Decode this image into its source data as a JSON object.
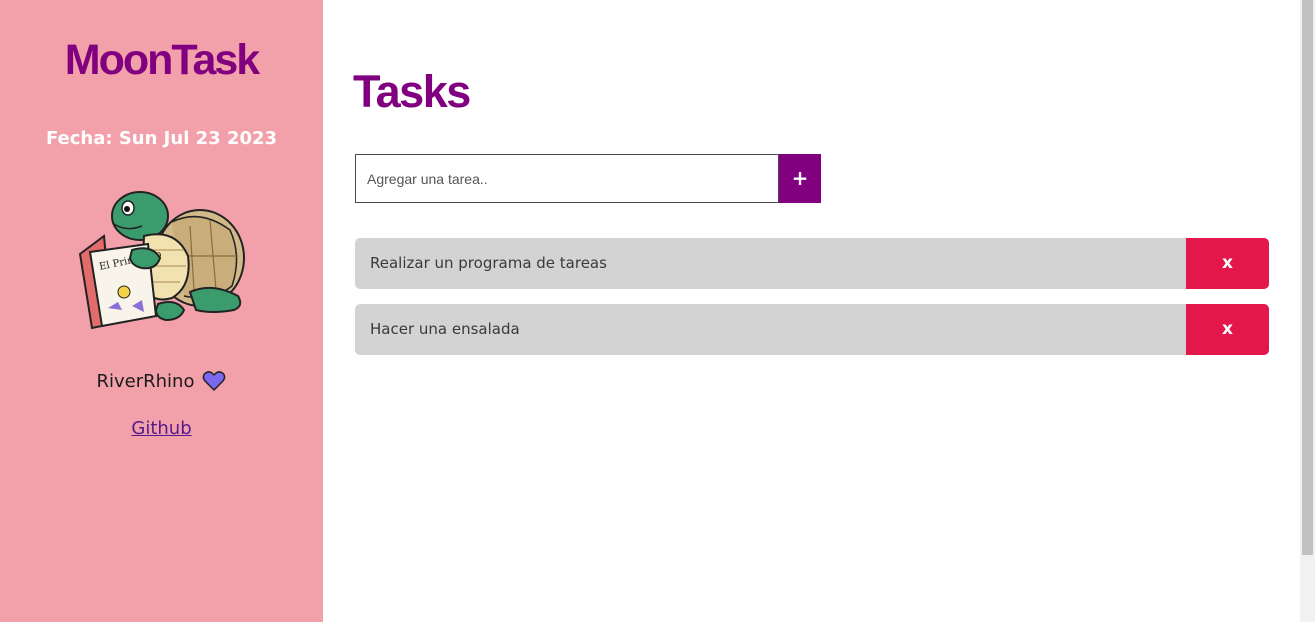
{
  "sidebar": {
    "brand": "MoonTask",
    "date_label": "Fecha: Sun Jul 23 2023",
    "mascot_icon": "turtle-reading-book-illustration",
    "mascot_book_title": "El Principito",
    "author": "RiverRhino",
    "author_icon": "purple-heart-icon",
    "github_link": "Github"
  },
  "main": {
    "title": "Tasks",
    "input": {
      "placeholder": "Agregar una tarea..",
      "value": ""
    },
    "add_button_label": "+",
    "tasks": [
      {
        "text": "Realizar un programa de tareas",
        "delete_label": "x"
      },
      {
        "text": "Hacer una ensalada",
        "delete_label": "x"
      }
    ]
  },
  "colors": {
    "sidebar_bg": "#f2a0aa",
    "accent": "#800080",
    "task_bg": "#d3d3d3",
    "delete_bg": "#e3174b",
    "heart": "#7b68ee"
  }
}
